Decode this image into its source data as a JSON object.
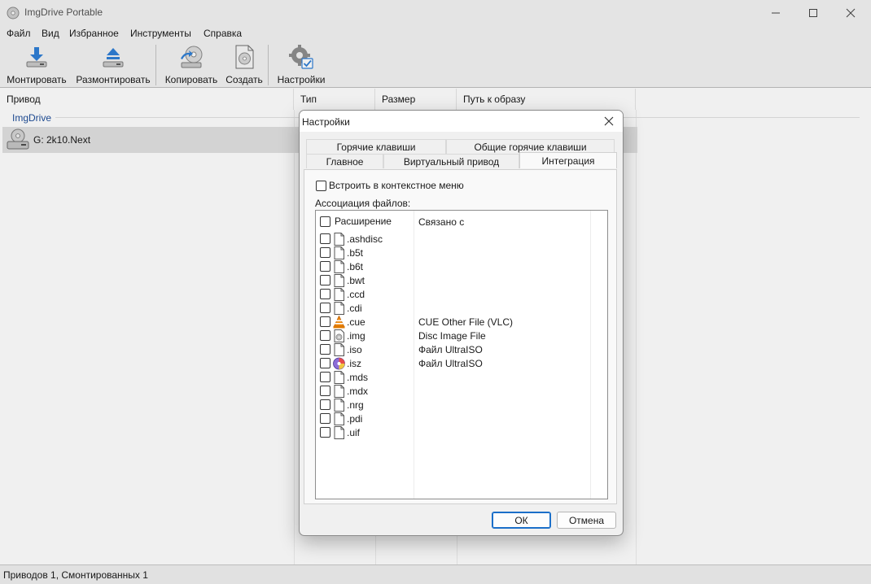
{
  "window": {
    "title": "ImgDrive Portable"
  },
  "menu": [
    "Файл",
    "Вид",
    "Избранное",
    "Инструменты",
    "Справка"
  ],
  "toolbar": {
    "mount": "Монтировать",
    "unmount": "Размонтировать",
    "copy": "Копировать",
    "create": "Создать",
    "settings": "Настройки"
  },
  "list": {
    "columns": [
      "Привод",
      "Тип",
      "Размер",
      "Путь к образу"
    ],
    "group": "ImgDrive",
    "drive": "G: 2k10.Next"
  },
  "status": "Приводов 1, Смонтированных 1",
  "dialog": {
    "title": "Настройки",
    "tabs_row1": [
      "Горячие клавиши",
      "Общие горячие клавиши"
    ],
    "tabs_row2": [
      "Главное",
      "Виртуальный привод",
      "Интеграция"
    ],
    "context_menu_label": "Встроить в контекстное меню",
    "assoc_label": "Ассоциация файлов:",
    "col_ext": "Расширение",
    "col_assoc": "Связано с",
    "files": [
      {
        "ext": ".ashdisc",
        "assoc": "",
        "icon": "file-icon"
      },
      {
        "ext": ".b5t",
        "assoc": "",
        "icon": "file-icon"
      },
      {
        "ext": ".b6t",
        "assoc": "",
        "icon": "file-icon"
      },
      {
        "ext": ".bwt",
        "assoc": "",
        "icon": "file-icon"
      },
      {
        "ext": ".ccd",
        "assoc": "",
        "icon": "file-icon"
      },
      {
        "ext": ".cdi",
        "assoc": "",
        "icon": "file-icon"
      },
      {
        "ext": ".cue",
        "assoc": "CUE Other File (VLC)",
        "icon": "vlc-cone-icon"
      },
      {
        "ext": ".img",
        "assoc": "Disc Image File",
        "icon": "disc-image-file-icon"
      },
      {
        "ext": ".iso",
        "assoc": "Файл UltraISO",
        "icon": "file-icon"
      },
      {
        "ext": ".isz",
        "assoc": "Файл UltraISO",
        "icon": "ultraiso-disc-icon"
      },
      {
        "ext": ".mds",
        "assoc": "",
        "icon": "file-icon"
      },
      {
        "ext": ".mdx",
        "assoc": "",
        "icon": "file-icon"
      },
      {
        "ext": ".nrg",
        "assoc": "",
        "icon": "file-icon"
      },
      {
        "ext": ".pdi",
        "assoc": "",
        "icon": "file-icon"
      },
      {
        "ext": ".uif",
        "assoc": "",
        "icon": "file-icon"
      }
    ],
    "ok": "ОК",
    "cancel": "Отмена"
  },
  "colors": {
    "accent": "#1b6fc9",
    "group_label": "#1f4e99",
    "selected_row": "#e1e1e1"
  }
}
